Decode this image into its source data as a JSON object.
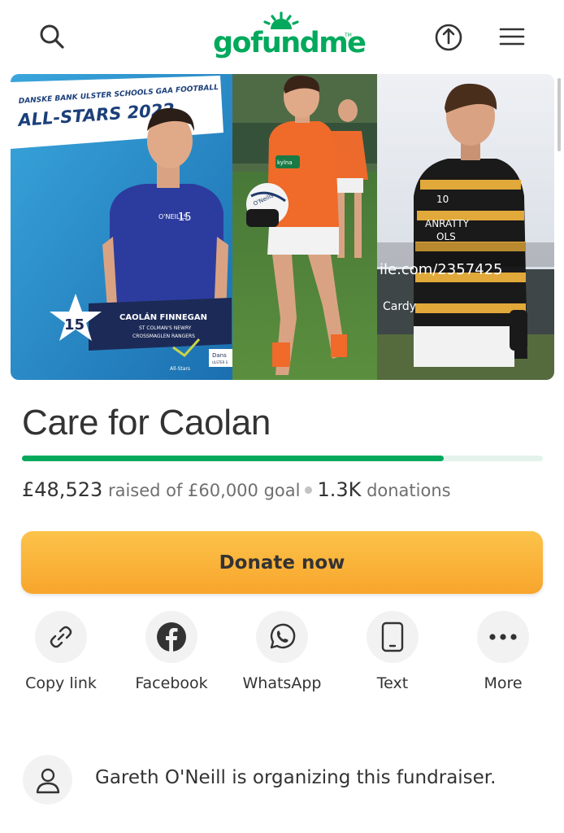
{
  "header": {
    "logo_text": "gofundme",
    "logo_tm": "TM",
    "brand_color": "#02a95c",
    "icons": [
      "search-icon",
      "share-upload-icon",
      "menu-icon"
    ]
  },
  "hero": {
    "photo1": {
      "banner_line1": "DANSKE BANK ULSTER SCHOOLS GAA FOOTBALL",
      "banner_line2": "ALL-STARS 2022",
      "jersey_brand": "O'NEILLS",
      "jersey_number": "15",
      "player_number": "15",
      "player_name": "CAOLÁN FINNEGAN",
      "player_school": "ST COLMAN'S NEWRY",
      "player_club": "CROSSMAGLEN RANGERS",
      "footer_logo": "All-Stars",
      "footer_sponsor": "Dans",
      "footer_sponsor_sub": "ULSTER S"
    },
    "photo2": {
      "ball_brand": "O'Neills",
      "shirt_sponsor": "kylna"
    },
    "photo3": {
      "shirt_number": "10",
      "sponsor_line1": "ANRATTY",
      "sponsor_line2": "OLS",
      "watermark_url": "ile.com/2357425",
      "watermark_credit": "Cardy"
    }
  },
  "campaign": {
    "title": "Care for Caolan",
    "raised": "£48,523",
    "raised_suffix": "raised of £60,000 goal",
    "donations_count": "1.3K",
    "donations_label": "donations",
    "progress_fraction": 0.81
  },
  "donate": {
    "label": "Donate now",
    "color_top": "#fcc34a",
    "color_bottom": "#f8a52c"
  },
  "share": {
    "items": [
      {
        "label": "Copy link",
        "icon": "link-icon"
      },
      {
        "label": "Facebook",
        "icon": "facebook-icon"
      },
      {
        "label": "WhatsApp",
        "icon": "whatsapp-icon"
      },
      {
        "label": "Text",
        "icon": "phone-icon"
      },
      {
        "label": "More",
        "icon": "more-dots-icon"
      }
    ]
  },
  "organizer": {
    "text": "Gareth O'Neill is organizing this fundraiser.",
    "icon": "person-icon"
  }
}
